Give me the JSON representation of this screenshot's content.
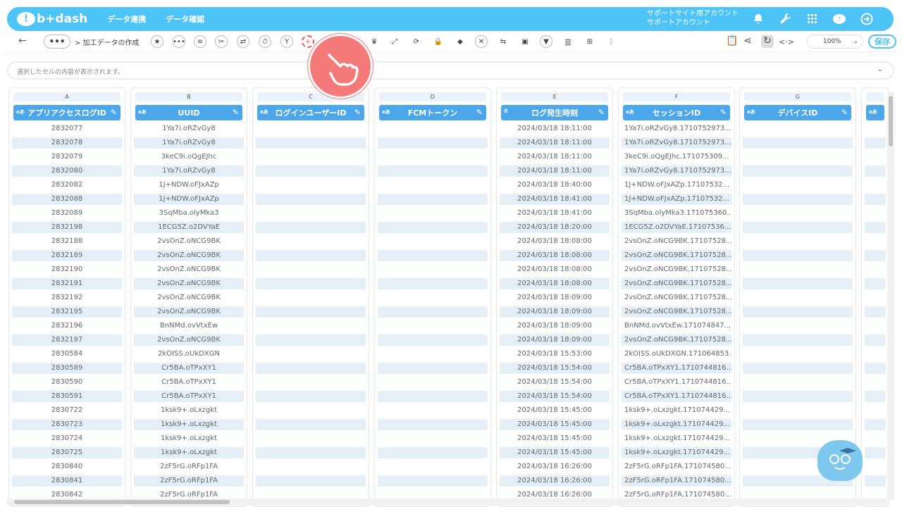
{
  "header": {
    "logo_text": "b+dash",
    "nav": [
      "データ連携",
      "データ確認"
    ],
    "account_line1": "サポートサイト用アカウント",
    "account_line2": "サポートアカウント"
  },
  "toolbar": {
    "back": "←",
    "more": "•••",
    "breadcrumb": "> 加工データの作成",
    "zoom": "100%",
    "save_label": "保存"
  },
  "cell_display": {
    "placeholder": "選択したセルの内容が表示されます。"
  },
  "columns": [
    {
      "letter": "A",
      "type": "aあ",
      "name": "アプリアクセスログID"
    },
    {
      "letter": "B",
      "type": "aあ",
      "name": "UUID"
    },
    {
      "letter": "C",
      "type": "aあ",
      "name": "ログインユーザーID"
    },
    {
      "letter": "D",
      "type": "aあ",
      "name": "FCMトークン"
    },
    {
      "letter": "E",
      "type": "⏱",
      "name": "ログ発生時刻"
    },
    {
      "letter": "F",
      "type": "aあ",
      "name": "セッションID"
    },
    {
      "letter": "G",
      "type": "aあ",
      "name": "デバイスID"
    },
    {
      "letter": "",
      "type": "aあ",
      "name": ""
    }
  ],
  "rows": [
    [
      "2832077",
      "1Ya7i.oRZvGy8",
      "2024/03/18 18:11:00",
      "1Ya7i.oRZvGy8.1710752973..."
    ],
    [
      "2832078",
      "1Ya7i.oRZvGy8",
      "2024/03/18 18:11:00",
      "1Ya7i.oRZvGy8.1710752973..."
    ],
    [
      "2832079",
      "3keC9i.oQgEJhc",
      "2024/03/18 18:11:00",
      "3keC9i.oQgEJhc.171075309..."
    ],
    [
      "2832080",
      "1Ya7i.oRZvGy8",
      "2024/03/18 18:11:00",
      "1Ya7i.oRZvGy8.1710752973..."
    ],
    [
      "2832082",
      "1J+NDW.oFJxAZp",
      "2024/03/18 18:40:00",
      "1J+NDW.oFJxAZp.17107532..."
    ],
    [
      "2832088",
      "1J+NDW.oFJxAZp",
      "2024/03/18 18:41:00",
      "1J+NDW.oFJxAZp.17107532..."
    ],
    [
      "2832089",
      "3SqMba.olyMka3",
      "2024/03/18 18:41:00",
      "3SqMba.olyMka3.171075360..."
    ],
    [
      "2832198",
      "1ECG5Z.o2DVYaE",
      "2024/03/18 18:20:00",
      "1ECG5Z.o2DVYaE.17107536..."
    ],
    [
      "2832188",
      "2vsOnZ.oNCG9BK",
      "2024/03/18 18:08:00",
      "2vsOnZ.oNCG9BK.17107528..."
    ],
    [
      "2832189",
      "2vsOnZ.oNCG9BK",
      "2024/03/18 18:08:00",
      "2vsOnZ.oNCG9BK.17107528..."
    ],
    [
      "2832190",
      "2vsOnZ.oNCG9BK",
      "2024/03/18 18:08:00",
      "2vsOnZ.oNCG9BK.17107528..."
    ],
    [
      "2832191",
      "2vsOnZ.oNCG9BK",
      "2024/03/18 18:08:00",
      "2vsOnZ.oNCG9BK.17107528..."
    ],
    [
      "2832192",
      "2vsOnZ.oNCG9BK",
      "2024/03/18 18:09:00",
      "2vsOnZ.oNCG9BK.17107528..."
    ],
    [
      "2832195",
      "2vsOnZ.oNCG9BK",
      "2024/03/18 18:09:00",
      "2vsOnZ.oNCG9BK.17107528..."
    ],
    [
      "2832196",
      "BnNMd.ovVtxEw",
      "2024/03/18 18:09:00",
      "BnNMd.ovVtxEw.171074847..."
    ],
    [
      "2832197",
      "2vsOnZ.oNCG9BK",
      "2024/03/18 18:09:00",
      "2vsOnZ.oNCG9BK.17107528..."
    ],
    [
      "2830584",
      "2kOISS.oUkDXGN",
      "2024/03/18 15:53:00",
      "2kOISS.oUkDXGN.171064853..."
    ],
    [
      "2830589",
      "Cr5BA.oTPxXY1",
      "2024/03/18 15:54:00",
      "Cr5BA.oTPxXY1.1710744816..."
    ],
    [
      "2830590",
      "Cr5BA.oTPxXY1",
      "2024/03/18 15:54:00",
      "Cr5BA.oTPxXY1.1710744816..."
    ],
    [
      "2830591",
      "Cr5BA.oTPxXY1",
      "2024/03/18 15:54:00",
      "Cr5BA.oTPxXY1.1710744816..."
    ],
    [
      "2830722",
      "1ksk9+.oLxzgkt",
      "2024/03/18 15:45:00",
      "1ksk9+.oLxzgkt.171074429..."
    ],
    [
      "2830723",
      "1ksk9+.oLxzgkt",
      "2024/03/18 15:45:00",
      "1ksk9+.oLxzgkt.171074429..."
    ],
    [
      "2830724",
      "1ksk9+.oLxzgkt",
      "2024/03/18 15:45:00",
      "1ksk9+.oLxzgkt.171074429..."
    ],
    [
      "2830725",
      "1ksk9+.oLxzgkt",
      "2024/03/18 15:45:00",
      "1ksk9+.oLxzgkt.171074429..."
    ],
    [
      "2830840",
      "2zF5rG.oRFp1FA",
      "2024/03/18 16:26:00",
      "2zF5rG.oRFp1FA.171074580..."
    ],
    [
      "2830841",
      "2zF5rG.oRFp1FA",
      "2024/03/18 16:26:00",
      "2zF5rG.oRFp1FA.171074580..."
    ],
    [
      "2830842",
      "2zF5rG.oRFp1FA",
      "2024/03/18 16:26:00",
      "2zF5rG.oRFp1FA.171074580..."
    ]
  ],
  "colors": {
    "brand": "#4ec3f5",
    "header_blue": "#4ba6ea",
    "alt_row": "#e4eff8",
    "highlight": "#f05a5a"
  }
}
